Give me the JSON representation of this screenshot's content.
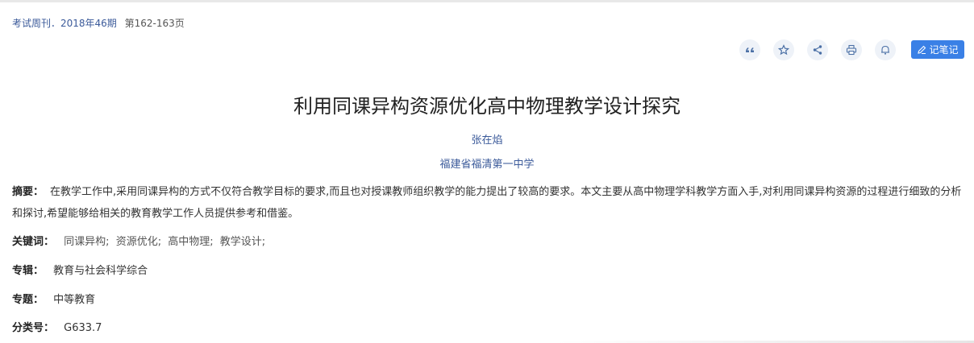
{
  "source": {
    "journal": "考试周刊．2018年46期",
    "pages": "第162-163页"
  },
  "toolbar": {
    "icons": [
      "quote-icon",
      "star-icon",
      "share-icon",
      "print-icon",
      "bell-icon"
    ],
    "note_label": "记笔记"
  },
  "article": {
    "title": "利用同课异构资源优化高中物理教学设计探究",
    "author": "张在焰",
    "organization": "福建省福清第一中学",
    "abstract_label": "摘要：",
    "abstract": "在教学工作中,采用同课异构的方式不仅符合教学目标的要求,而且也对授课教师组织教学的能力提出了较高的要求。本文主要从高中物理学科教学方面入手,对利用同课异构资源的过程进行细致的分析和探讨,希望能够给相关的教育教学工作人员提供参考和借鉴。",
    "keywords_label": "关键词：",
    "keywords": [
      "同课异构;",
      "资源优化;",
      "高中物理;",
      "教学设计;"
    ],
    "series_label": "专辑：",
    "series": "教育与社会科学综合",
    "topic_label": "专题：",
    "topic": "中等教育",
    "classification_label": "分类号：",
    "classification": "G633.7"
  },
  "colors": {
    "link": "#3b5a9a",
    "accent": "#3a80e6",
    "icon_bg": "#eef2f8"
  }
}
